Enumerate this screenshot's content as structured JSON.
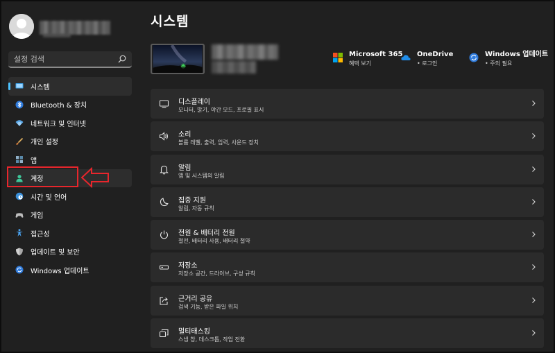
{
  "sidebar": {
    "search_placeholder": "설정 검색",
    "items": [
      {
        "label": "시스템",
        "icon": "system-icon"
      },
      {
        "label": "Bluetooth & 장치",
        "icon": "bluetooth-icon"
      },
      {
        "label": "네트워크 및 인터넷",
        "icon": "wifi-icon"
      },
      {
        "label": "개인 설정",
        "icon": "brush-icon"
      },
      {
        "label": "앱",
        "icon": "apps-icon"
      },
      {
        "label": "계정",
        "icon": "person-icon"
      },
      {
        "label": "시간 및 언어",
        "icon": "globe-clock-icon"
      },
      {
        "label": "게임",
        "icon": "gamepad-icon"
      },
      {
        "label": "접근성",
        "icon": "accessibility-icon"
      },
      {
        "label": "업데이트 및 보안",
        "icon": "shield-icon"
      },
      {
        "label": "Windows 업데이트",
        "icon": "refresh-icon"
      }
    ]
  },
  "main": {
    "title": "시스템",
    "quick_links": [
      {
        "title": "Microsoft 365",
        "sub": "혜택 보기",
        "icon": "microsoft-logo-icon"
      },
      {
        "title": "OneDrive",
        "sub": "• 로그인",
        "icon": "cloud-icon"
      },
      {
        "title": "Windows 업데이트",
        "sub": "• 주의 필요",
        "icon": "update-icon"
      }
    ],
    "cards": [
      {
        "title": "디스플레이",
        "sub": "모니터, 밝기, 야간 모드, 프로필 표시",
        "icon": "monitor-icon"
      },
      {
        "title": "소리",
        "sub": "볼륨 레벨, 출력, 입력, 사운드 장치",
        "icon": "speaker-icon"
      },
      {
        "title": "알림",
        "sub": "앱 및 시스템의 알림",
        "icon": "bell-icon"
      },
      {
        "title": "집중 지원",
        "sub": "알림, 자동 규칙",
        "icon": "moon-icon"
      },
      {
        "title": "전원 & 배터리 전원",
        "sub": "절전, 배터리 사용, 배터리 절약",
        "icon": "power-icon"
      },
      {
        "title": "저장소",
        "sub": "저장소 공간, 드라이브, 구성 규칙",
        "icon": "storage-icon"
      },
      {
        "title": "근거리 공유",
        "sub": "검색 기능, 받은 파일 위치",
        "icon": "share-icon"
      },
      {
        "title": "멀티태스킹",
        "sub": "스냅 창, 데스크톱, 작업 전환",
        "icon": "multitask-icon"
      }
    ]
  },
  "colors": {
    "background": "#202020",
    "card": "#2b2b2b",
    "accent": "#4cc2ff",
    "annotation_red": "#e8262c"
  }
}
